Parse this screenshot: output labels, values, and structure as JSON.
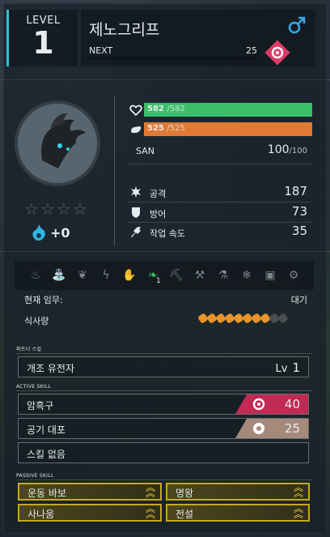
{
  "header": {
    "level_label": "LEVEL",
    "level": "1",
    "name": "제노그리프",
    "next_label": "NEXT",
    "next_value": "25",
    "next_progress": 0,
    "gender_icon": "male-icon",
    "element_icon": "dark-element-icon",
    "colors": {
      "accent": "#2fc0d8",
      "male": "#3aa6e6",
      "dark_element": "#e03a67"
    }
  },
  "portrait": {
    "icon": "pal-portrait",
    "stars": 0,
    "max_stars": 4,
    "soul_icon": "soul-flame-icon",
    "soul_value": "+0"
  },
  "stats": {
    "hp": {
      "current": "582",
      "max": "/582",
      "color": "#3cbf6a"
    },
    "stamina": {
      "current": "525",
      "max": "/525",
      "color": "#e07a33"
    },
    "san": {
      "label": "SAN",
      "current": "100",
      "max": "/100"
    },
    "attack": {
      "label": "공격",
      "value": "187",
      "icon": "attack-icon"
    },
    "defense": {
      "label": "방어",
      "value": "73",
      "icon": "shield-icon"
    },
    "work_speed": {
      "label": "작업 속도",
      "value": "35",
      "icon": "work-speed-icon"
    }
  },
  "work": {
    "icons": [
      {
        "name": "kindling-icon",
        "glyph": "♨",
        "active": false
      },
      {
        "name": "watering-icon",
        "glyph": "⛲",
        "active": false
      },
      {
        "name": "planting-icon",
        "glyph": "❦",
        "active": false
      },
      {
        "name": "electricity-icon",
        "glyph": "ϟ",
        "active": false
      },
      {
        "name": "handiwork-icon",
        "glyph": "✋",
        "active": false
      },
      {
        "name": "gathering-icon",
        "glyph": "❧",
        "active": true,
        "level": "1"
      },
      {
        "name": "lumbering-icon",
        "glyph": "⛏",
        "active": false
      },
      {
        "name": "mining-icon",
        "glyph": "⚒",
        "active": false
      },
      {
        "name": "medicine-icon",
        "glyph": "⚗",
        "active": false
      },
      {
        "name": "cooling-icon",
        "glyph": "❄",
        "active": false
      },
      {
        "name": "transporting-icon",
        "glyph": "▣",
        "active": false
      },
      {
        "name": "farming-icon",
        "glyph": "⚙",
        "active": false
      }
    ],
    "task_label": "현재 임무:",
    "task_value": "대기",
    "food_label": "식사량",
    "food_total": 10,
    "food_filled": 8
  },
  "skills": {
    "partner_title": "파트너 스킬",
    "partner": {
      "name": "개조 유전자",
      "lv_label": "Lv",
      "lv": "1"
    },
    "active_title": "ACTIVE SKILL",
    "active": [
      {
        "name": "암흑구",
        "power": "40",
        "element": "dark",
        "color": "#c02a55"
      },
      {
        "name": "공기 대포",
        "power": "25",
        "element": "neutral",
        "color": "#a58a7c"
      },
      {
        "name": "스킬 없음",
        "power": "",
        "element": "",
        "color": ""
      }
    ],
    "passive_title": "PASSIVE SKILL",
    "passive": [
      {
        "name": "운동 바보",
        "rank_icon": "rank-up-icon"
      },
      {
        "name": "명왕",
        "rank_icon": "rank-up-icon"
      },
      {
        "name": "사나움",
        "rank_icon": "rank-up-icon"
      },
      {
        "name": "전설",
        "rank_icon": "rank-up-icon"
      }
    ]
  }
}
